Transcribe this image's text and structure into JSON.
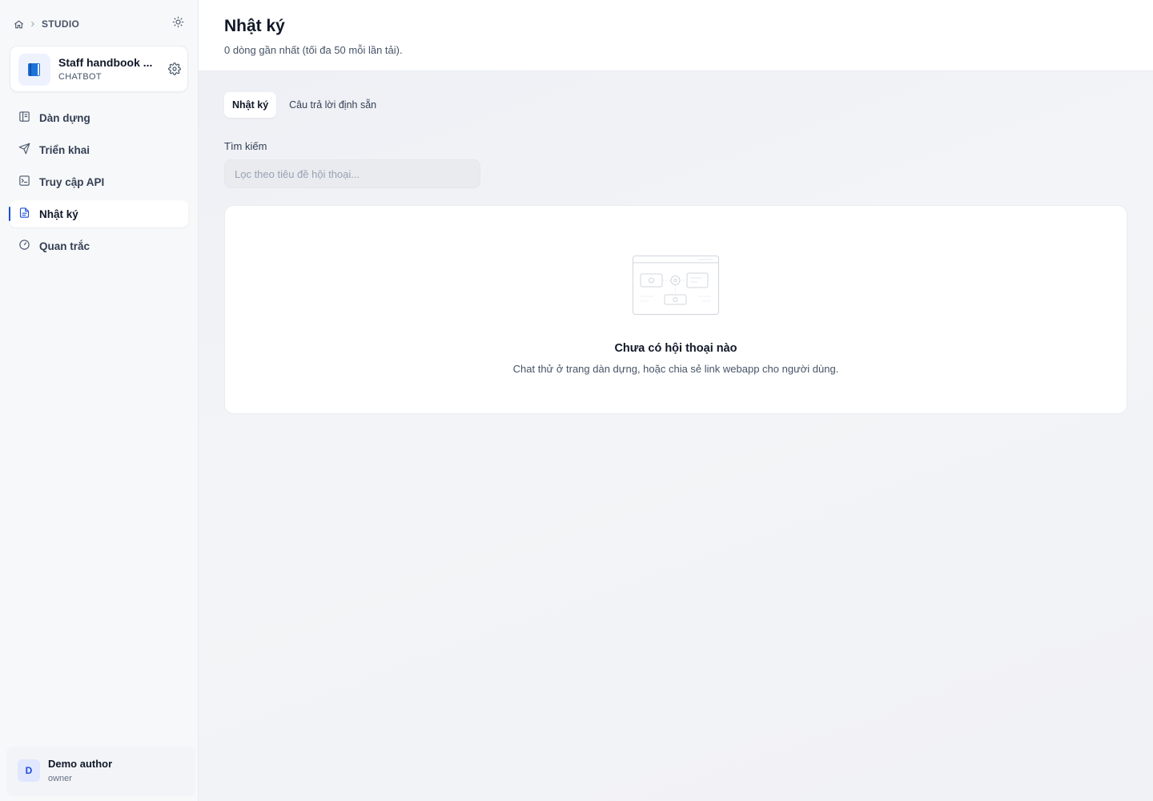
{
  "breadcrumb": {
    "section": "STUDIO"
  },
  "app": {
    "name": "Staff handbook ...",
    "type": "CHATBOT"
  },
  "nav": [
    {
      "label": "Dàn dựng",
      "icon": "layout-icon"
    },
    {
      "label": "Triển khai",
      "icon": "send-icon"
    },
    {
      "label": "Truy cập API",
      "icon": "terminal-icon"
    },
    {
      "label": "Nhật ký",
      "icon": "document-icon",
      "active": true
    },
    {
      "label": "Quan trắc",
      "icon": "gauge-icon"
    }
  ],
  "user": {
    "initial": "D",
    "name": "Demo author",
    "role": "owner"
  },
  "header": {
    "title": "Nhật ký",
    "subtitle": "0 dòng gần nhất (tối đa 50 mỗi lần tải)."
  },
  "tabs": [
    {
      "label": "Nhật ký",
      "active": true
    },
    {
      "label": "Câu trả lời định sẵn",
      "active": false
    }
  ],
  "search": {
    "label": "Tìm kiếm",
    "placeholder": "Lọc theo tiêu đề hội thoại...",
    "value": ""
  },
  "empty": {
    "title": "Chưa có hội thoại nào",
    "description": "Chat thử ở trang dàn dựng, hoặc chia sẻ link webapp cho người dùng."
  },
  "colors": {
    "accent": "#1d4ed8",
    "sidebar_bg": "#f7f8fa",
    "main_bg": "#f2f4f7"
  }
}
